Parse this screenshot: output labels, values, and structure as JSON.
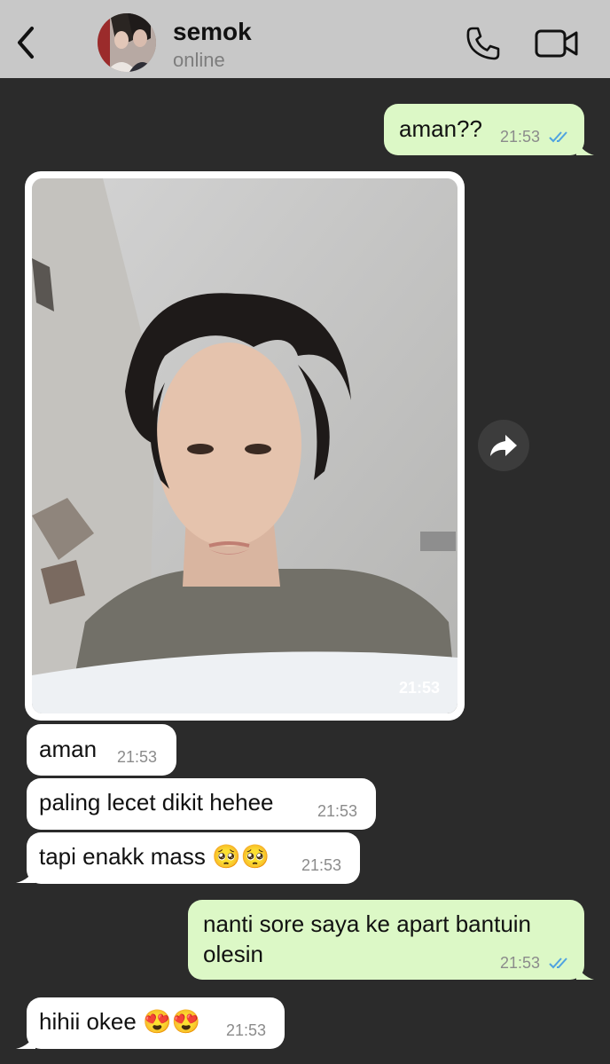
{
  "header": {
    "contact_name": "semok",
    "status": "online",
    "back_icon": "chevron-left-icon",
    "call_icon": "phone-icon",
    "video_icon": "video-camera-icon",
    "background": "#c8c8c8"
  },
  "chat": {
    "background": "#2b2b2b",
    "outgoing_color": "#dcf8c6",
    "incoming_color": "#ffffff",
    "read_tick_color": "#4fa3e0"
  },
  "messages": [
    {
      "direction": "out",
      "text": "aman??",
      "time": "21:53",
      "status": "read"
    },
    {
      "direction": "in",
      "type": "photo",
      "time": "21:53"
    },
    {
      "direction": "in",
      "text": "aman",
      "time": "21:53"
    },
    {
      "direction": "in",
      "text": "paling lecet dikit hehee",
      "time": "21:53"
    },
    {
      "direction": "in",
      "text": "tapi enakk mass 🥺🥺",
      "time": "21:53"
    },
    {
      "direction": "out",
      "text_line1": "nanti sore saya ke apart bantuin",
      "text_line2": "olesin",
      "time": "21:53",
      "status": "read"
    },
    {
      "direction": "in",
      "text": "hihii okee 😍😍",
      "time": "21:53"
    }
  ],
  "forward_icon": "forward-arrow-icon"
}
